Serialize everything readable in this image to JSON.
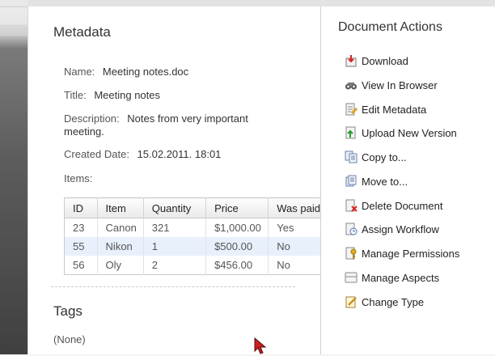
{
  "metadata": {
    "title": "Metadata",
    "fields": {
      "name_label": "Name:",
      "name_value": "Meeting notes.doc",
      "title_label": "Title:",
      "title_value": "Meeting notes",
      "description_label": "Description:",
      "description_value": "Notes from very important meeting.",
      "created_label": "Created Date:",
      "created_value": "15.02.2011. 18:01",
      "items_label": "Items:"
    },
    "table": {
      "headers": [
        "ID",
        "Item",
        "Quantity",
        "Price",
        "Was paid"
      ],
      "rows": [
        [
          "23",
          "Canon",
          "321",
          "$1,000.00",
          "Yes"
        ],
        [
          "55",
          "Nikon",
          "1",
          "$500.00",
          "No"
        ],
        [
          "56",
          "Oly",
          "2",
          "$456.00",
          "No"
        ]
      ]
    }
  },
  "tags": {
    "title": "Tags",
    "none": "(None)"
  },
  "actions": {
    "title": "Document Actions",
    "items": [
      {
        "label": "Download",
        "icon": "download-icon"
      },
      {
        "label": "View In Browser",
        "icon": "view-in-browser-icon"
      },
      {
        "label": "Edit Metadata",
        "icon": "edit-metadata-icon"
      },
      {
        "label": "Upload New Version",
        "icon": "upload-icon"
      },
      {
        "label": "Copy to...",
        "icon": "copy-icon"
      },
      {
        "label": "Move to...",
        "icon": "move-icon"
      },
      {
        "label": "Delete Document",
        "icon": "delete-icon"
      },
      {
        "label": "Assign Workflow",
        "icon": "workflow-icon"
      },
      {
        "label": "Manage Permissions",
        "icon": "permissions-icon"
      },
      {
        "label": "Manage Aspects",
        "icon": "aspects-icon"
      },
      {
        "label": "Change Type",
        "icon": "change-type-icon"
      }
    ]
  }
}
